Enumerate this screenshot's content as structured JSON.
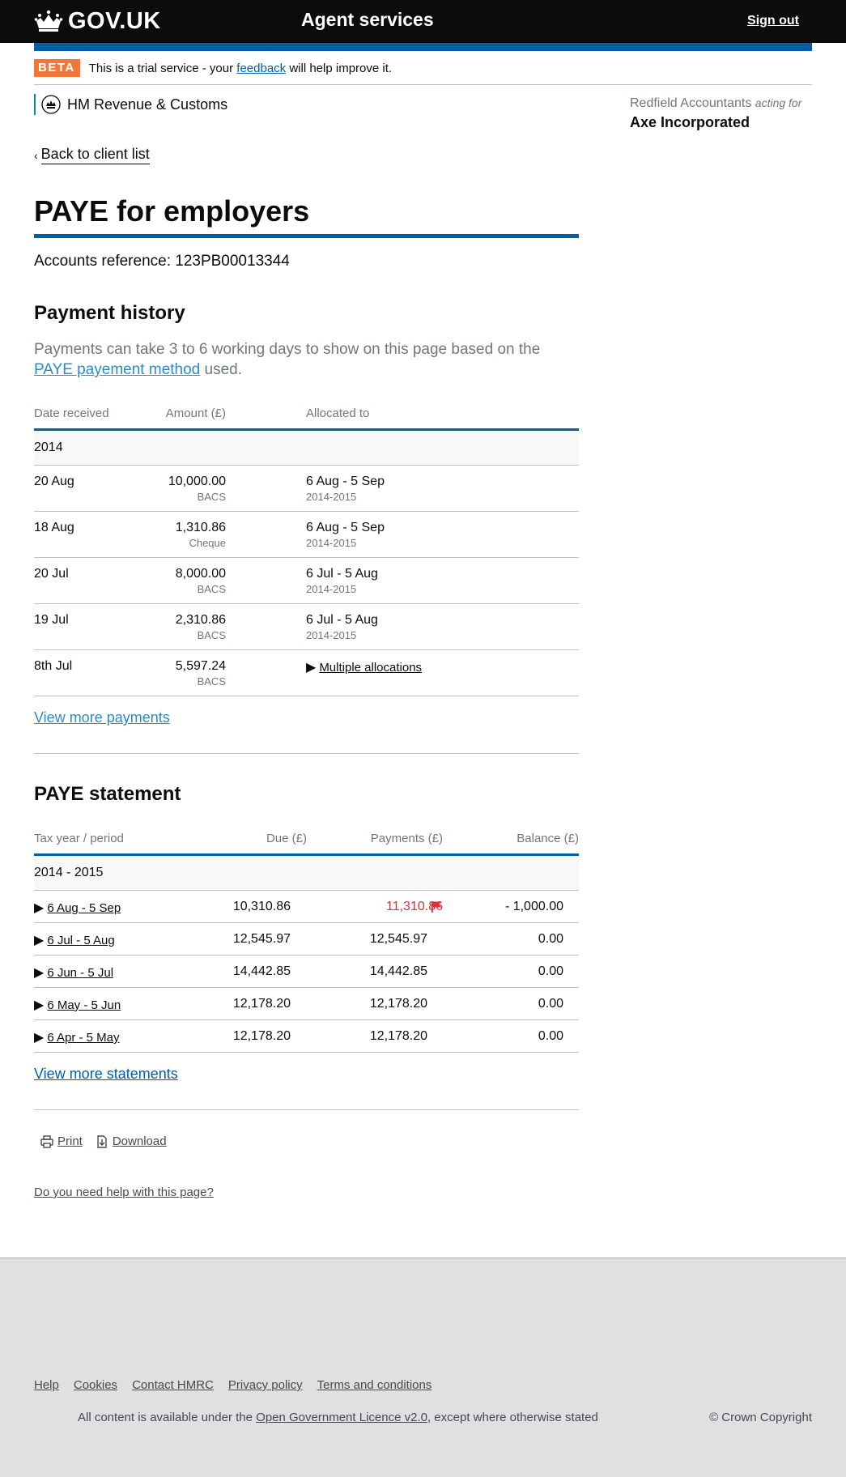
{
  "header": {
    "logo_text": "GOV.UK",
    "service_name": "Agent services",
    "signout": "Sign out"
  },
  "beta": {
    "tag": "BETA",
    "text_before": "This is a trial service - your",
    "link": "feedback",
    "text_after": "will help improve it."
  },
  "org": {
    "name": "HM Revenue & Customs"
  },
  "account": {
    "agent": "Redfield Accountants",
    "acting_for": "acting for",
    "client": "Axe Incorporated"
  },
  "back_link": "Back to client list",
  "page_title": "PAYE for employers",
  "accounts_reference": "Accounts reference: 123PB00013344",
  "payment_history": {
    "heading": "Payment history",
    "intro_before": "Payments can take 3 to 6 working days to show on this page based on the",
    "intro_link": "PAYE payement method",
    "intro_after": "used.",
    "columns": [
      "Date received",
      "Amount (£)",
      "Allocated to"
    ],
    "year": "2014",
    "rows": [
      {
        "date": "20 Aug",
        "amount": "10,000.00",
        "method": "BACS",
        "allocated": "6 Aug - 5 Sep",
        "allocated_year": "2014-2015"
      },
      {
        "date": "18 Aug",
        "amount": "1,310.86",
        "method": "Cheque",
        "allocated": "6 Aug - 5 Sep",
        "allocated_year": "2014-2015"
      },
      {
        "date": "20 Jul",
        "amount": "8,000.00",
        "method": "BACS",
        "allocated": "6 Jul - 5 Aug",
        "allocated_year": "2014-2015"
      },
      {
        "date": "19 Jul",
        "amount": "2,310.86",
        "method": "BACS",
        "allocated": "6 Jul - 5 Aug",
        "allocated_year": "2014-2015"
      },
      {
        "date": "8th Jul",
        "amount": "5,597.24",
        "method": "BACS",
        "allocated": "Multiple allocations",
        "allocated_year": ""
      }
    ],
    "view_more": "View more payments"
  },
  "statement": {
    "heading": "PAYE statement",
    "columns": [
      "Tax year / period",
      "Due (£)",
      "Payments (£)",
      "Balance (£)"
    ],
    "year": "2014 - 2015",
    "rows": [
      {
        "period": "6 Aug - 5 Sep",
        "due": "10,310.86",
        "payments": "11,310.86",
        "balance": "- 1,000.00"
      },
      {
        "period": "6 Jul - 5 Aug",
        "due": "12,545.97",
        "payments": "12,545.97",
        "balance": "0.00"
      },
      {
        "period": "6 Jun - 5 Jul",
        "due": "14,442.85",
        "payments": "14,442.85",
        "balance": "0.00"
      },
      {
        "period": "6 May - 5 Jun",
        "due": "12,178.20",
        "payments": "12,178.20",
        "balance": "0.00"
      },
      {
        "period": "6 Apr - 5 May",
        "due": "12,178.20",
        "payments": "12,178.20",
        "balance": "0.00"
      }
    ],
    "view_more": "View more statements"
  },
  "actions": {
    "print": "Print",
    "download": "Download"
  },
  "help_link": "Do you need help with this page?",
  "footer": {
    "links": [
      "Help",
      "Cookies",
      "Contact HMRC",
      "Privacy policy",
      "Terms and conditions"
    ],
    "licence_before": "All content is available under the",
    "licence_link": "Open Government Licence v2.0",
    "licence_after": ", except where otherwise stated",
    "copyright": "© Crown Copyright"
  },
  "colors": {
    "header_bg": "#0b0c0c",
    "brand_blue": "#005ea5",
    "beta_orange": "#f47738",
    "overpaid_red": "#df3034",
    "footer_bg": "#dee0e2"
  },
  "icons": [
    "crown-icon",
    "hmrc-crest-icon",
    "chevron-left-icon",
    "triangle-right-icon",
    "flag-icon",
    "printer-icon",
    "download-icon"
  ]
}
